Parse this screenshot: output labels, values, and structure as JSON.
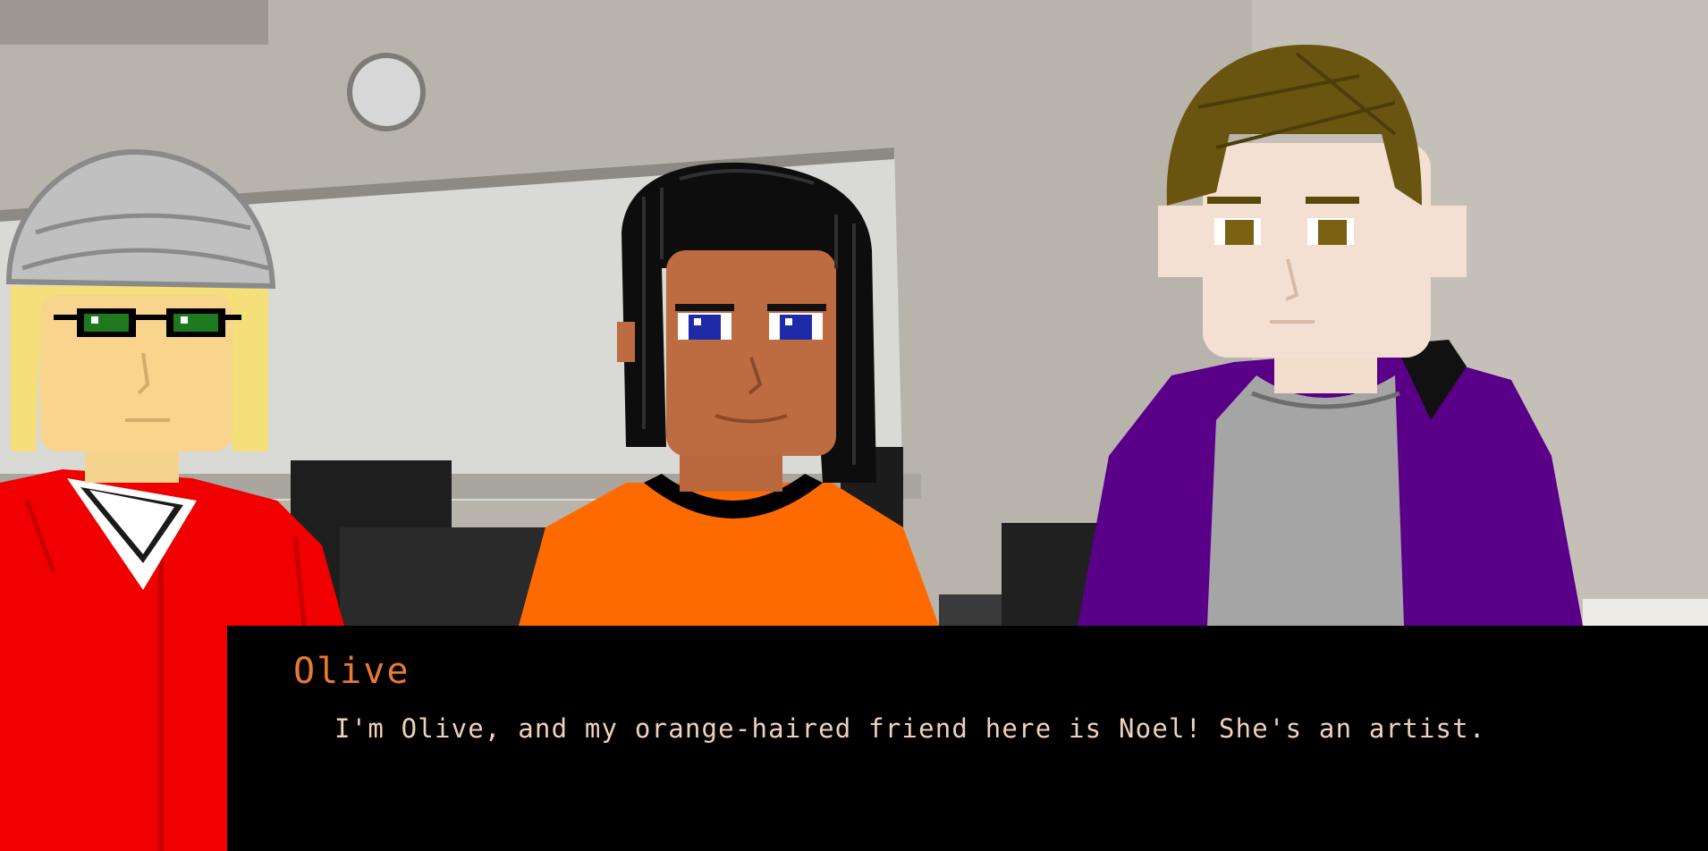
{
  "dialogue": {
    "speaker": "Olive",
    "line": "I'm Olive, and my orange-haired friend here is Noel! She's an artist."
  },
  "characters": [
    {
      "role": "left",
      "outfit": "red-hoodie",
      "hat": "grey-beanie",
      "hair": "blonde",
      "eyes": "green"
    },
    {
      "role": "center",
      "outfit": "orange-shirt",
      "hair": "black",
      "eyes": "blue"
    },
    {
      "role": "right",
      "outfit": "purple-hoodie",
      "hair": "brown",
      "eyes": "brown"
    }
  ],
  "colors": {
    "name_color": "#e87a32",
    "text_color": "#f0d2bc",
    "red_hoodie": "#f00000",
    "orange_shirt": "#ff6a00",
    "purple_hoodie": "#5a0088",
    "box_bg": "#000000"
  }
}
